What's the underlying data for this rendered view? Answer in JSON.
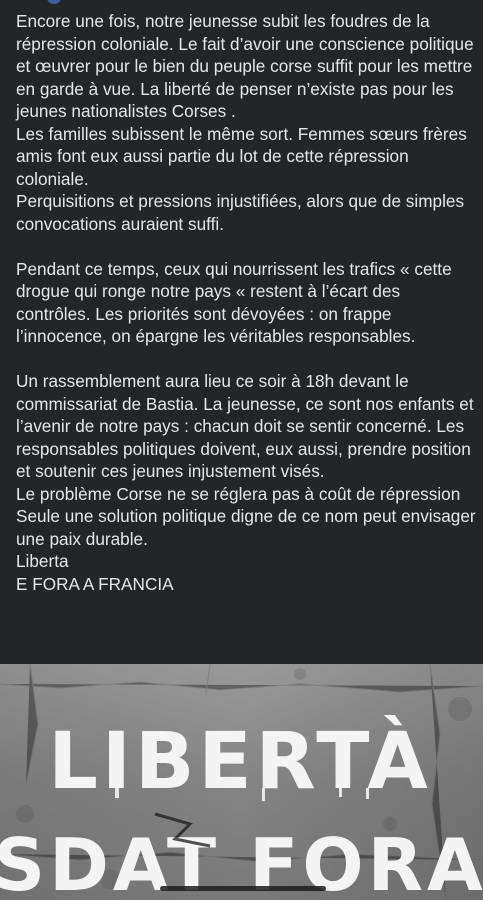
{
  "post": {
    "paragraph_1": "Encore une fois, notre jeunesse subit les foudres de la répression coloniale. Le fait d’avoir une conscience politique et œuvrer pour le bien du peuple corse suffit pour les mettre en garde à vue. La liberté de penser n’existe pas pour les jeunes nationalistes Corses .\nLes familles subissent le même sort. Femmes sœurs frères amis font eux aussi partie du lot de cette répression coloniale.\nPerquisitions et pressions injustifiées, alors que de simples convocations auraient suffi.",
    "paragraph_2": "Pendant ce temps, ceux qui nourrissent les trafics « cette drogue qui ronge notre pays « restent à l’écart des contrôles. Les priorités sont dévoyées : on frappe l’innocence, on épargne les véritables responsables.",
    "paragraph_3": "Un rassemblement aura lieu ce soir à 18h devant le commissariat de Bastia. La jeunesse, ce sont nos enfants et l’avenir de notre pays : chacun doit se sentir concerné. Les responsables politiques doivent, eux aussi, prendre position et soutenir ces jeunes injustement visés.\nLe problème Corse ne se réglera pas à coût de répression\nSeule une solution politique digne de ce nom peut envisager une paix durable.\nLiberta\nE FORA A FRANCIA"
  },
  "photo": {
    "graffiti_line_1": "LIBERTÀ",
    "graffiti_line_2": "SDAT FORA"
  },
  "colors": {
    "background": "#242526",
    "text": "#e4e6eb",
    "graffiti": "#f4f4f4"
  }
}
